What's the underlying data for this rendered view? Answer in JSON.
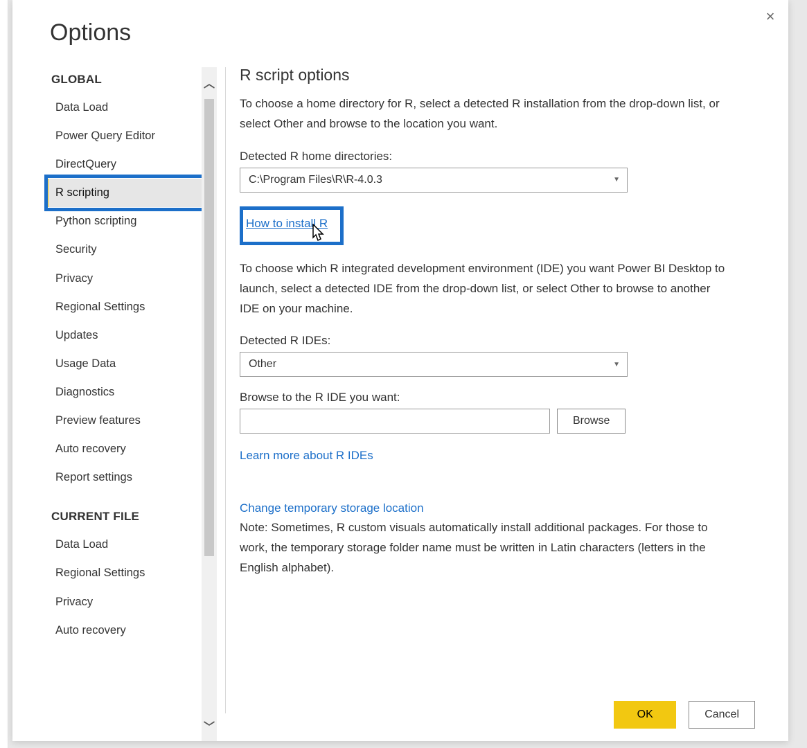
{
  "dialog": {
    "title": "Options",
    "close_icon": "×"
  },
  "sidebar": {
    "groups": [
      {
        "header": "GLOBAL",
        "items": [
          "Data Load",
          "Power Query Editor",
          "DirectQuery",
          "R scripting",
          "Python scripting",
          "Security",
          "Privacy",
          "Regional Settings",
          "Updates",
          "Usage Data",
          "Diagnostics",
          "Preview features",
          "Auto recovery",
          "Report settings"
        ]
      },
      {
        "header": "CURRENT FILE",
        "items": [
          "Data Load",
          "Regional Settings",
          "Privacy",
          "Auto recovery"
        ]
      }
    ],
    "selected": "R scripting"
  },
  "main": {
    "panel_title": "R script options",
    "desc1": "To choose a home directory for R, select a detected R installation from the drop-down list, or select Other and browse to the location you want.",
    "detected_home_label": "Detected R home directories:",
    "detected_home_value": "C:\\Program Files\\R\\R-4.0.3",
    "link_install": "How to install R",
    "desc2": "To choose which R integrated development environment (IDE) you want Power BI Desktop to launch, select a detected IDE from the drop-down list, or select Other to browse to another IDE on your machine.",
    "detected_ide_label": "Detected R IDEs:",
    "detected_ide_value": "Other",
    "browse_label": "Browse to the R IDE you want:",
    "browse_value": "",
    "browse_btn": "Browse",
    "link_learn": "Learn more about R IDEs",
    "link_storage": "Change temporary storage location",
    "note": "Note: Sometimes, R custom visuals automatically install additional packages. For those to work, the temporary storage folder name must be written in Latin characters (letters in the English alphabet)."
  },
  "footer": {
    "ok": "OK",
    "cancel": "Cancel"
  }
}
